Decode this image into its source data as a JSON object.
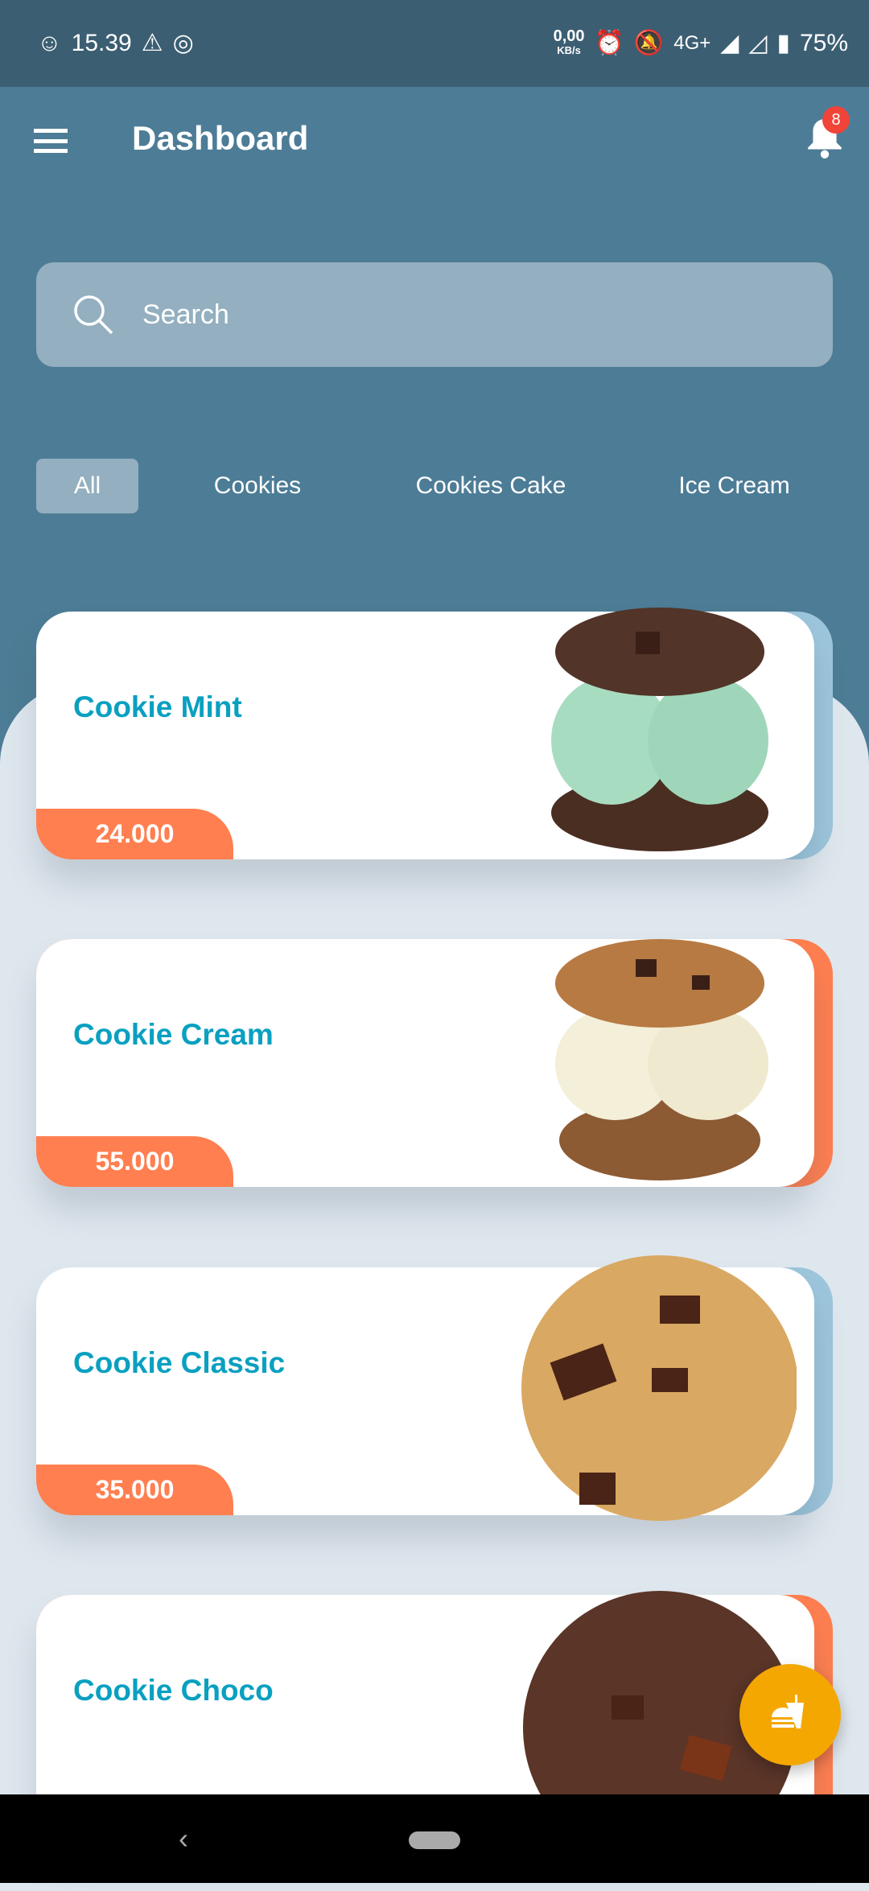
{
  "status_bar": {
    "time": "15.39",
    "net_speed": "0,00",
    "net_unit": "KB/s",
    "network": "4G+",
    "battery": "75%"
  },
  "header": {
    "title": "Dashboard",
    "notification_count": "8"
  },
  "search": {
    "placeholder": "Search"
  },
  "tabs": [
    {
      "label": "All",
      "active": true
    },
    {
      "label": "Cookies"
    },
    {
      "label": "Cookies Cake"
    },
    {
      "label": "Ice Cream"
    }
  ],
  "products": [
    {
      "name": "Cookie Mint",
      "price": "24.000",
      "accent": "#9dc6dc"
    },
    {
      "name": "Cookie Cream",
      "price": "55.000",
      "accent": "#ff7f50"
    },
    {
      "name": "Cookie Classic",
      "price": "35.000",
      "accent": "#9dc6dc"
    },
    {
      "name": "Cookie Choco",
      "price": "",
      "accent": "#ff7f50"
    }
  ],
  "colors": {
    "appbar": "#4d7c96",
    "title": "#0aa0c0",
    "price": "#ff7f50",
    "fab": "#f4a700"
  }
}
